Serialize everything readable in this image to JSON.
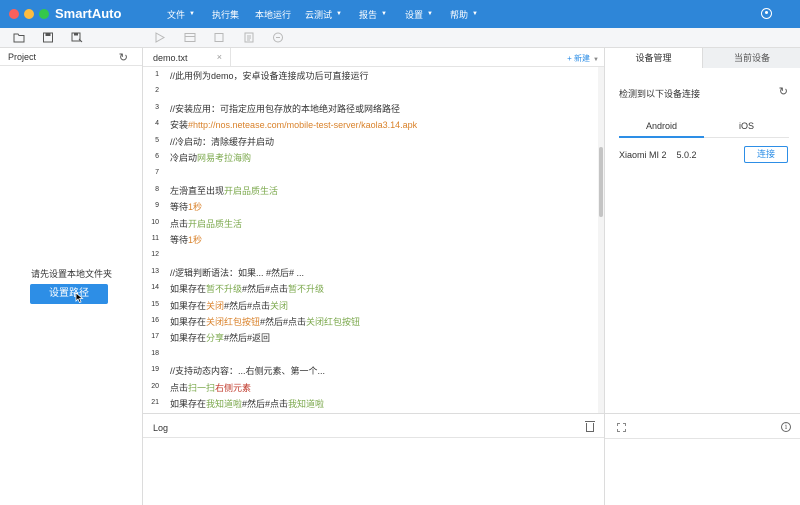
{
  "app": {
    "title": "SmartAuto"
  },
  "menu": [
    {
      "label": "文件",
      "dropdown": true
    },
    {
      "label": "执行集",
      "dropdown": false
    },
    {
      "label": "本地运行",
      "dropdown": false
    },
    {
      "label": "云测试",
      "dropdown": true
    },
    {
      "label": "报告",
      "dropdown": true
    },
    {
      "label": "设置",
      "dropdown": true
    },
    {
      "label": "帮助",
      "dropdown": true
    }
  ],
  "toolbar": {
    "icons": [
      "folder-icon",
      "save-icon",
      "save-as-icon",
      "run-icon",
      "record-icon",
      "stop-icon",
      "report-icon",
      "cloud-run-icon"
    ]
  },
  "project": {
    "title": "Project",
    "hint": "请先设置本地文件夹",
    "set_path_button": "设置路径"
  },
  "editor": {
    "tab": "demo.txt",
    "close_glyph": "×",
    "new_label": "+ 新建",
    "lines": [
      {
        "n": "1",
        "parts": [
          {
            "t": "//此用例为demo，安卓设备连接成功后可直接运行",
            "c": ""
          }
        ]
      },
      {
        "n": "2",
        "parts": []
      },
      {
        "n": "3",
        "parts": [
          {
            "t": "//安装应用：可指定应用包存放的本地绝对路径或网络路径",
            "c": ""
          }
        ]
      },
      {
        "n": "4",
        "parts": [
          {
            "t": "安装",
            "c": ""
          },
          {
            "t": "#http://nos.netease.com/mobile-test-server/kaola3.14.apk",
            "c": "o"
          }
        ]
      },
      {
        "n": "5",
        "parts": [
          {
            "t": "//冷启动：清除缓存并启动",
            "c": ""
          }
        ]
      },
      {
        "n": "6",
        "parts": [
          {
            "t": "冷启动",
            "c": ""
          },
          {
            "t": "网易考拉海购",
            "c": "g"
          }
        ]
      },
      {
        "n": "7",
        "parts": []
      },
      {
        "n": "8",
        "parts": [
          {
            "t": "左滑直至出现",
            "c": ""
          },
          {
            "t": "开启品质生活",
            "c": "g"
          }
        ]
      },
      {
        "n": "9",
        "parts": [
          {
            "t": "等待",
            "c": ""
          },
          {
            "t": "1秒",
            "c": "o"
          }
        ]
      },
      {
        "n": "10",
        "parts": [
          {
            "t": "点击",
            "c": ""
          },
          {
            "t": "开启品质生活",
            "c": "g"
          }
        ]
      },
      {
        "n": "11",
        "parts": [
          {
            "t": "等待",
            "c": ""
          },
          {
            "t": "1秒",
            "c": "o"
          }
        ]
      },
      {
        "n": "12",
        "parts": []
      },
      {
        "n": "13",
        "parts": [
          {
            "t": "//逻辑判断语法：如果... #然后# ...",
            "c": ""
          }
        ]
      },
      {
        "n": "14",
        "parts": [
          {
            "t": "如果存在",
            "c": ""
          },
          {
            "t": "暂不升级",
            "c": "g"
          },
          {
            "t": "#然后#点击",
            "c": ""
          },
          {
            "t": "暂不升级",
            "c": "g"
          }
        ]
      },
      {
        "n": "15",
        "parts": [
          {
            "t": "如果存在",
            "c": ""
          },
          {
            "t": "关闭",
            "c": "o"
          },
          {
            "t": "#然后#点击",
            "c": ""
          },
          {
            "t": "关闭",
            "c": "g"
          }
        ]
      },
      {
        "n": "16",
        "parts": [
          {
            "t": "如果存在",
            "c": ""
          },
          {
            "t": "关闭红包按钮",
            "c": "o"
          },
          {
            "t": "#然后#点击",
            "c": ""
          },
          {
            "t": "关闭红包按钮",
            "c": "g"
          }
        ]
      },
      {
        "n": "17",
        "parts": [
          {
            "t": "如果存在",
            "c": ""
          },
          {
            "t": "分享",
            "c": "g"
          },
          {
            "t": "#然后#返回",
            "c": ""
          }
        ]
      },
      {
        "n": "18",
        "parts": []
      },
      {
        "n": "19",
        "parts": [
          {
            "t": "//支持动态内容：...右侧元素、第一个...",
            "c": ""
          }
        ]
      },
      {
        "n": "20",
        "parts": [
          {
            "t": "点击",
            "c": ""
          },
          {
            "t": "扫一扫",
            "c": "g"
          },
          {
            "t": "右侧元素",
            "c": "r"
          }
        ]
      },
      {
        "n": "21",
        "parts": [
          {
            "t": "如果存在",
            "c": ""
          },
          {
            "t": "我知道啦",
            "c": "g"
          },
          {
            "t": "#然后#点击",
            "c": ""
          },
          {
            "t": "我知道啦",
            "c": "g"
          }
        ]
      }
    ]
  },
  "log": {
    "title": "Log"
  },
  "device": {
    "tab_manage": "设备管理",
    "tab_current": "当前设备",
    "detect_text": "检测到以下设备连接",
    "platform_android": "Android",
    "platform_ios": "iOS",
    "device_name": "Xiaomi MI 2",
    "device_version": "5.0.2",
    "connect_button": "连接"
  },
  "colors": {
    "titlebar": "#2e86d8",
    "accent": "#2d8ee6",
    "keyword_green": "#7ba84c",
    "value_orange": "#d9822b",
    "modifier_red": "#c0392b"
  }
}
